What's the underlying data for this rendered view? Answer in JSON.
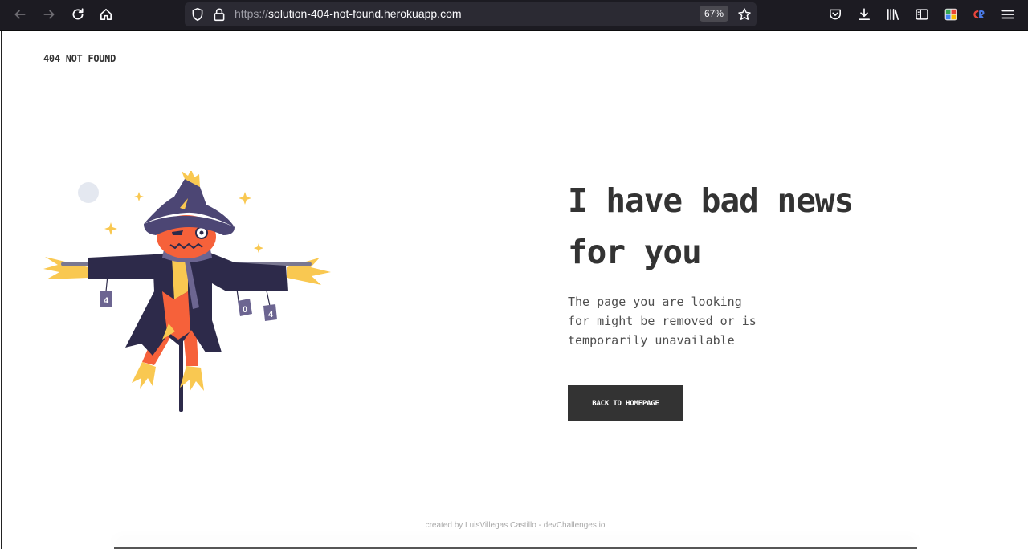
{
  "browser": {
    "url_scheme": "https://",
    "url_host": "solution-404-not-found.herokuapp.com",
    "zoom": "67%",
    "icons": [
      "back-icon",
      "forward-icon",
      "reload-icon",
      "home-icon",
      "shield-icon",
      "lock-icon",
      "star-icon",
      "pocket-icon",
      "download-icon",
      "library-icon",
      "sidebar-icon",
      "extension-icon",
      "extension-icon",
      "menu-icon"
    ]
  },
  "page": {
    "brand": "404 NOT FOUND",
    "headline_line1": "I have bad news",
    "headline_line2": "for you",
    "desc_line1": "The page you are looking",
    "desc_line2": "for might be removed or is",
    "desc_line3": "temporarily unavailable",
    "cta_label": "BACK TO HOMEPAGE",
    "illustration_digits": [
      "4",
      "0",
      "4"
    ],
    "footer": "created by LuisVillegas Castillo - devChallenges.io"
  },
  "colors": {
    "text": "#333333",
    "button": "#333333",
    "scarecrow_face": "#f6613a",
    "hat": "#4c4674",
    "coat": "#2d2a4a",
    "straw": "#f9c851"
  }
}
